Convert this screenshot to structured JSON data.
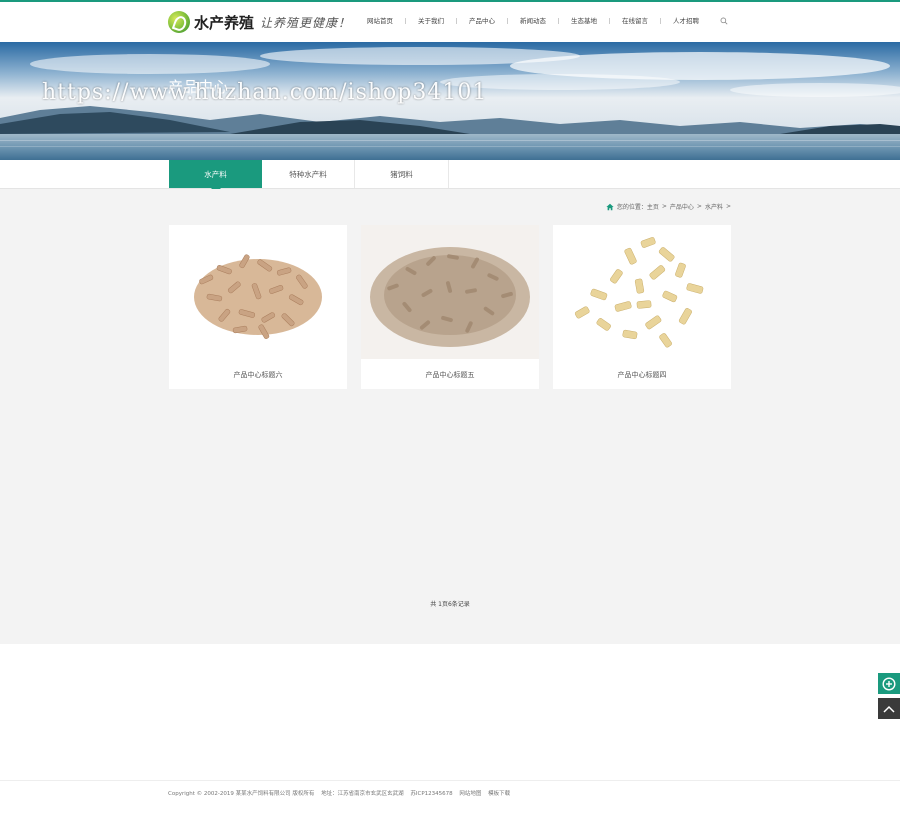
{
  "header": {
    "logo_text": "水产养殖",
    "slogan": "让养殖更健康！",
    "nav": [
      "网站首页",
      "关于我们",
      "产品中心",
      "新闻动态",
      "生态基地",
      "在线留言",
      "人才招聘"
    ]
  },
  "banner": {
    "title": "产品中心",
    "watermark": "https://www.huzhan.com/ishop34101"
  },
  "tabs": [
    "水产料",
    "特种水产料",
    "猪饲料"
  ],
  "breadcrumb": {
    "prefix": "您的位置：",
    "home": "主页",
    "sep1": ">",
    "category": "产品中心",
    "sep2": ">",
    "current": "水产料",
    "sep3": ">"
  },
  "products": [
    {
      "title": "产品中心标题六"
    },
    {
      "title": "产品中心标题五"
    },
    {
      "title": "产品中心标题四"
    }
  ],
  "pager": "共 1页6条记录",
  "footer": {
    "copyright": "Copyright © 2002-2019 某某水产饲料有限公司 版权所有",
    "address": "地址：江苏省南京市玄武区玄武湖",
    "icp": "苏ICP12345678",
    "sitemap": "网站地图",
    "template": "模板下载"
  },
  "colors": {
    "accent": "#1a9a7e",
    "main_bg": "#f3f3f3"
  }
}
